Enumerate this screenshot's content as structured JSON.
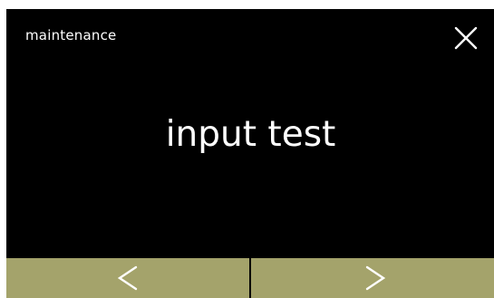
{
  "header": {
    "title": "maintenance",
    "close_icon": "close-icon"
  },
  "main": {
    "title": "input test"
  },
  "footer": {
    "prev_icon": "chevron-left-icon",
    "next_icon": "chevron-right-icon"
  },
  "colors": {
    "background": "#000000",
    "text": "#ffffff",
    "footer_bar": "#a4a36b",
    "divider": "#000000"
  }
}
